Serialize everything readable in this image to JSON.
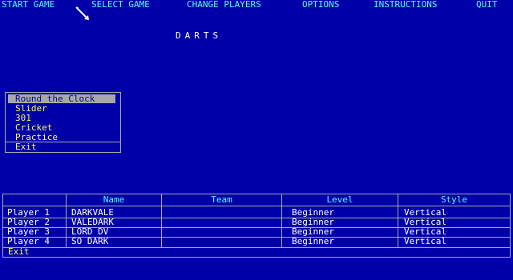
{
  "menu": {
    "start_game": "START GAME",
    "select_game": "SELECT GAME",
    "change_players": "CHANGE PLAYERS",
    "options": "OPTIONS",
    "instructions": "INSTRUCTIONS",
    "quit": "QUIT"
  },
  "title": "DARTS",
  "game_menu": {
    "items": [
      "Round the Clock",
      "Slider",
      "301",
      "Cricket",
      "Practice"
    ],
    "selected": "Round the Clock",
    "exit": "Exit"
  },
  "players": {
    "columns": [
      "Name",
      "Team",
      "Level",
      "Style"
    ],
    "rows": [
      {
        "label": "Player 1",
        "name": "DARKVALE",
        "team": "",
        "level": "Beginner",
        "style": "Vertical"
      },
      {
        "label": "Player 2",
        "name": "VALEDARK",
        "team": "",
        "level": "Beginner",
        "style": "Vertical"
      },
      {
        "label": "Player 3",
        "name": "LORD DV",
        "team": "",
        "level": "Beginner",
        "style": "Vertical"
      },
      {
        "label": "Player 4",
        "name": "SO DARK",
        "team": "",
        "level": "Beginner",
        "style": "Vertical"
      }
    ],
    "exit": "Exit"
  },
  "colors": {
    "background": "#0000a8",
    "menu_text": "#54fcfc",
    "option_text": "#fcfc54",
    "highlight": "#a8a8a8"
  },
  "icons": {
    "cursor": "dart-cursor-icon"
  }
}
